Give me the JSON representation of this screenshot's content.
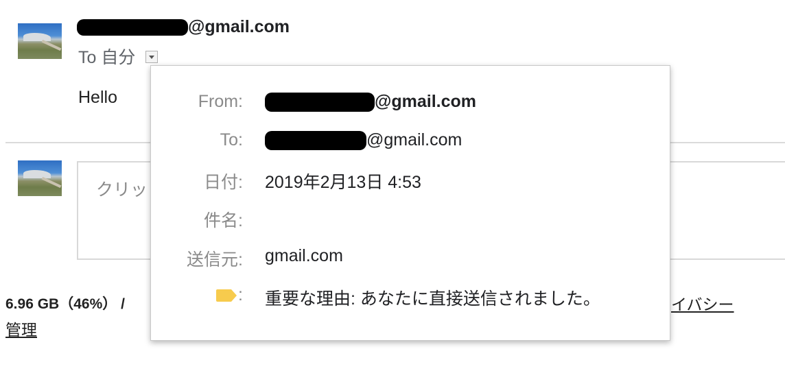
{
  "message": {
    "sender_domain": "@gmail.com",
    "to_label": "To",
    "to_value": "自分",
    "body": "Hello"
  },
  "reply": {
    "placeholder": "クリッ"
  },
  "footer": {
    "storage_text": "6.96 GB（46%） / ",
    "privacy_link": "イバシー",
    "manage_link": "管理"
  },
  "details_popup": {
    "from_label": "From:",
    "from_value": "@gmail.com",
    "to_label": "To:",
    "to_value": "@gmail.com",
    "date_label": "日付:",
    "date_value": "2019年2月13日 4:53",
    "subject_label": "件名:",
    "subject_value": "",
    "mailed_by_label": "送信元:",
    "mailed_by_value": "gmail.com",
    "importance_label": ":",
    "importance_value": "重要な理由: あなたに直接送信されました。",
    "importance_icon": "label-important-icon",
    "importance_color": "#f7cb4d"
  }
}
